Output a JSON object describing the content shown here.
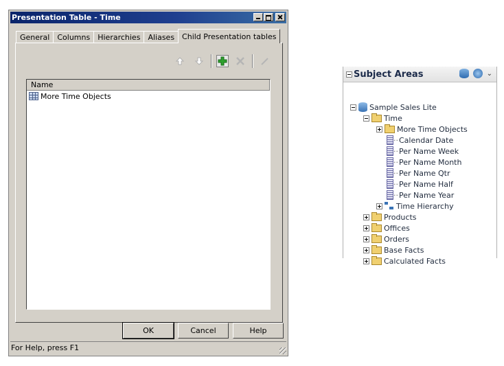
{
  "dialog": {
    "title": "Presentation Table - Time",
    "tabs": [
      "General",
      "Columns",
      "Hierarchies",
      "Aliases",
      "Child Presentation tables"
    ],
    "active_tab": "Child Presentation tables",
    "list_header": "Name",
    "items": [
      "More Time Objects"
    ],
    "buttons": {
      "ok": "OK",
      "cancel": "Cancel",
      "help": "Help"
    },
    "status": "For Help, press F1"
  },
  "subject_areas": {
    "title": "Subject Areas",
    "tree": {
      "root": "Sample Sales Lite",
      "time": "Time",
      "time_children": {
        "more_time_objects": "More Time Objects",
        "calendar_date": "Calendar Date",
        "per_name_week": "Per Name Week",
        "per_name_month": "Per Name Month",
        "per_name_qtr": "Per Name Qtr",
        "per_name_half": "Per Name Half",
        "per_name_year": "Per Name Year",
        "time_hierarchy": "Time Hierarchy"
      },
      "products": "Products",
      "offices": "Offices",
      "orders": "Orders",
      "base_facts": "Base Facts",
      "calculated_facts": "Calculated Facts"
    }
  },
  "icons": [
    "up-arrow-icon",
    "down-arrow-icon",
    "add-icon",
    "delete-icon",
    "edit-icon",
    "table-icon",
    "folder-icon",
    "database-icon",
    "column-icon",
    "hierarchy-icon"
  ],
  "colors": {
    "titlebar": "#0a246a",
    "dialog_face": "#d4d0c8",
    "folder": "#f0d070",
    "add_green": "#2ea12e"
  }
}
